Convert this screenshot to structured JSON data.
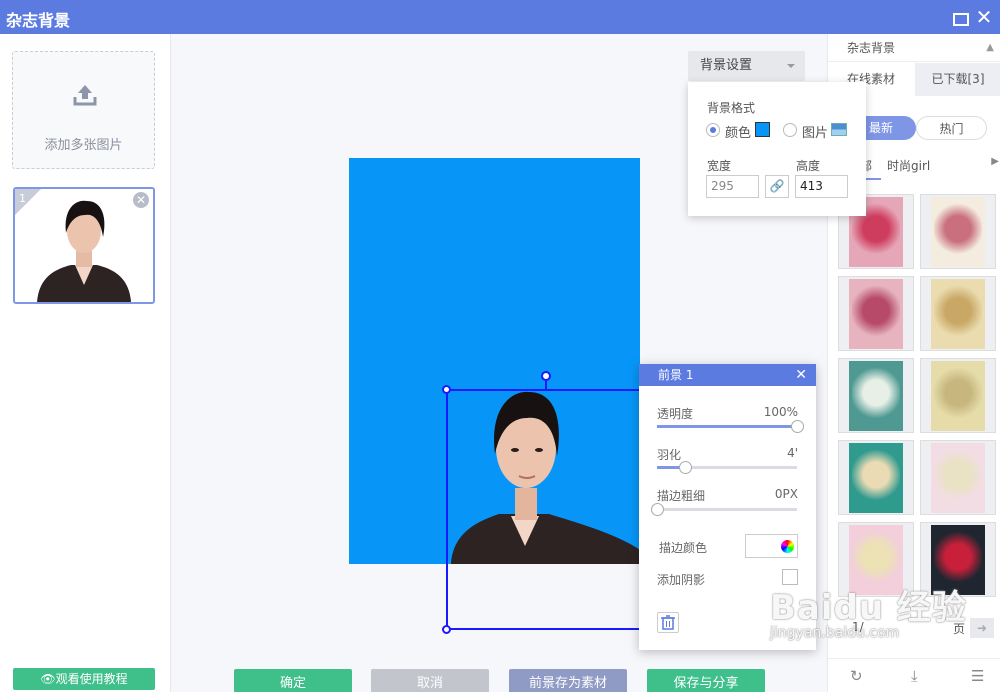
{
  "window": {
    "title": "杂志背景",
    "close_glyph": "✕"
  },
  "left_panel": {
    "add_label": "添加多张图片",
    "thumb": {
      "number": "1",
      "remove_glyph": "✕"
    },
    "tutorial": "观看使用教程"
  },
  "canvas": {
    "background_color": "#0796f7"
  },
  "bottom_buttons": {
    "ok": "确定",
    "cancel": "取消",
    "save_material": "前景存为素材",
    "save_share": "保存与分享"
  },
  "bg_settings": {
    "button_label": "背景设置",
    "format_label": "背景格式",
    "option_color": "颜色",
    "option_image": "图片",
    "selected_option": "颜色",
    "width_label": "宽度",
    "height_label": "高度",
    "width_value": "295",
    "height_value": "413"
  },
  "foreground_panel": {
    "title": "前景 1",
    "opacity_label": "透明度",
    "opacity_value": "100%",
    "opacity_level": 1.0,
    "feather_label": "羽化",
    "feather_value": "4'",
    "feather_level": 0.2,
    "stroke_width_label": "描边粗细",
    "stroke_width_value": "0PX",
    "stroke_width_level": 0.0,
    "stroke_color_label": "描边颜色",
    "shadow_label": "添加阴影"
  },
  "right_panel": {
    "dropdown": "杂志背景",
    "tab_online": "在线素材",
    "tab_downloaded": "已下载[3]",
    "filter_new": "最新",
    "filter_hot": "热门",
    "cat_all": "部",
    "cat_fashion": "时尚girl",
    "templates": [
      {
        "icon": "ice-cream-poster-red"
      },
      {
        "icon": "ice-cream-poster-pink"
      },
      {
        "icon": "vintage-poster-red"
      },
      {
        "icon": "vintage-frame-beige"
      },
      {
        "icon": "floral-frame-teal"
      },
      {
        "icon": "floral-oval-frame"
      },
      {
        "icon": "teal-frame-flowers"
      },
      {
        "icon": "pink-floral-frame"
      },
      {
        "icon": "pink-roses-frame"
      },
      {
        "icon": "boston-heart-poster"
      }
    ],
    "page_current": "1/",
    "page_suffix": "页"
  },
  "watermark": {
    "line1": "Baidu 经验",
    "line2": "jingyan.baidu.com"
  }
}
